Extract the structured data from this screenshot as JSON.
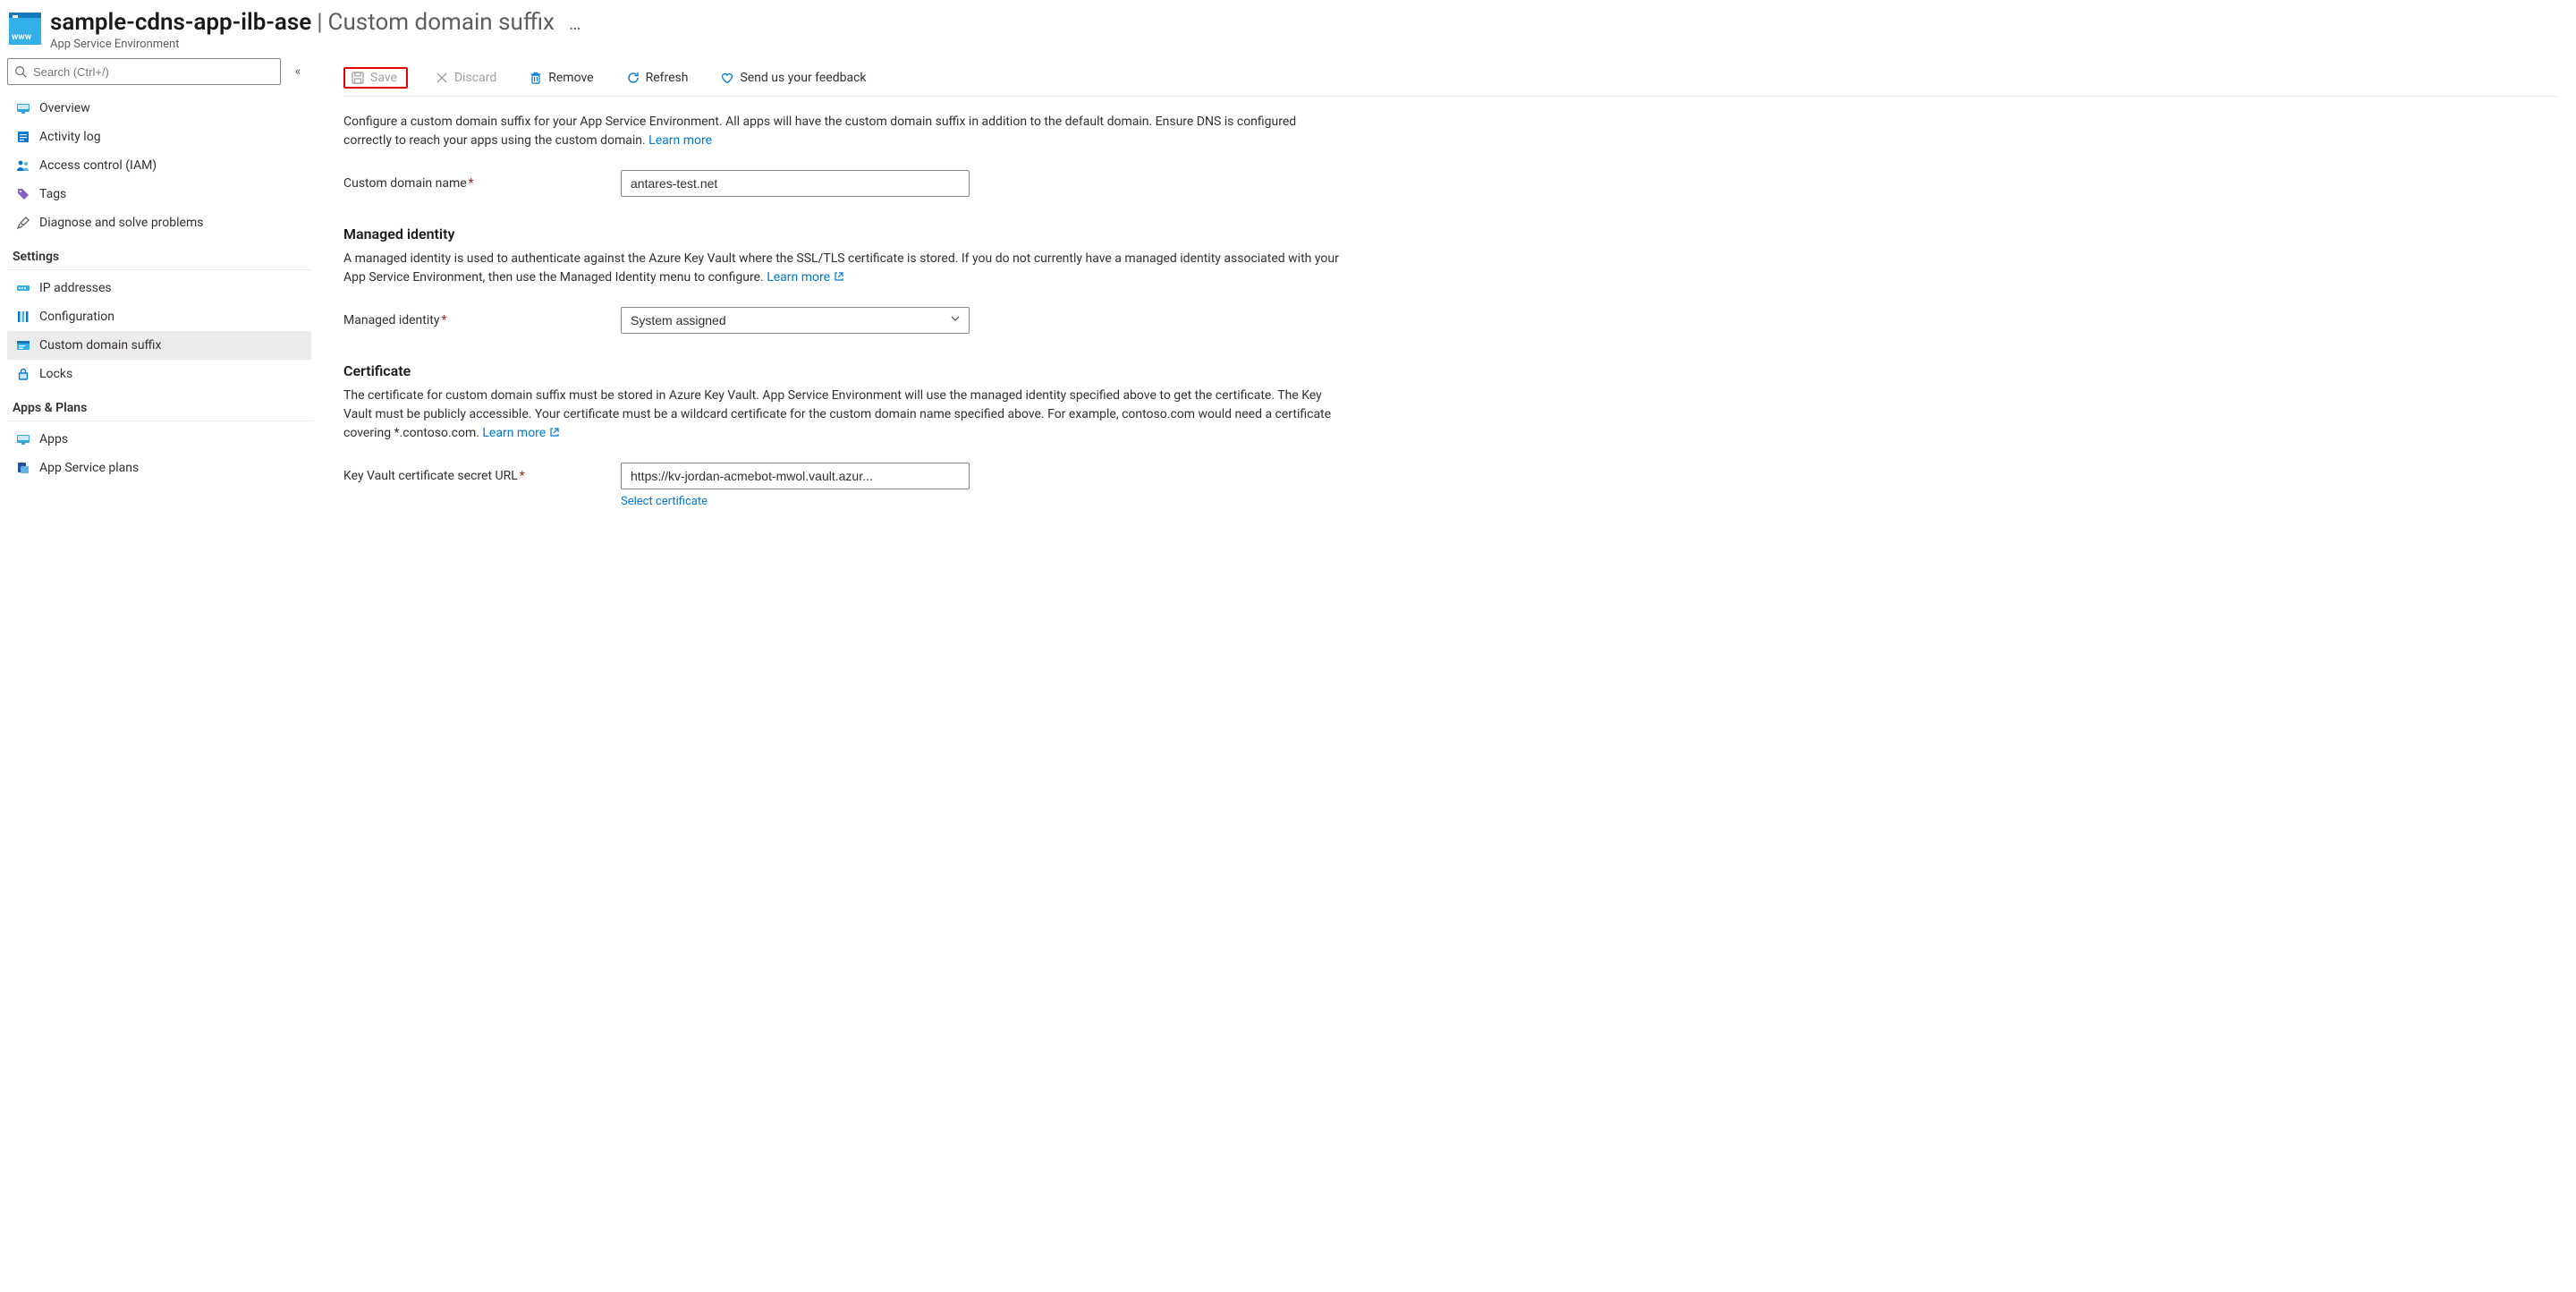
{
  "header": {
    "resource_name": "sample-cdns-app-ilb-ase",
    "separator": "|",
    "blade_name": "Custom domain suffix",
    "resource_type": "App Service Environment",
    "more": "…"
  },
  "search": {
    "placeholder": "Search (Ctrl+/)"
  },
  "sidebar": {
    "items": [
      {
        "label": "Overview"
      },
      {
        "label": "Activity log"
      },
      {
        "label": "Access control (IAM)"
      },
      {
        "label": "Tags"
      },
      {
        "label": "Diagnose and solve problems"
      }
    ],
    "settings_label": "Settings",
    "settings": [
      {
        "label": "IP addresses"
      },
      {
        "label": "Configuration"
      },
      {
        "label": "Custom domain suffix"
      },
      {
        "label": "Locks"
      }
    ],
    "apps_label": "Apps & Plans",
    "apps": [
      {
        "label": "Apps"
      },
      {
        "label": "App Service plans"
      }
    ]
  },
  "toolbar": {
    "save": "Save",
    "discard": "Discard",
    "remove": "Remove",
    "refresh": "Refresh",
    "feedback": "Send us your feedback"
  },
  "content": {
    "intro_text": "Configure a custom domain suffix for your App Service Environment. All apps will have the custom domain suffix in addition to the default domain. Ensure DNS is configured correctly to reach your apps using the custom domain. ",
    "learn_more": "Learn more",
    "custom_domain_label": "Custom domain name",
    "custom_domain_value": "antares-test.net",
    "managed_identity_heading": "Managed identity",
    "managed_identity_desc": "A managed identity is used to authenticate against the Azure Key Vault where the SSL/TLS certificate is stored. If you do not currently have a managed identity associated with your App Service Environment, then use the Managed Identity menu to configure. ",
    "managed_identity_label": "Managed identity",
    "managed_identity_value": "System assigned",
    "certificate_heading": "Certificate",
    "certificate_desc": "The certificate for custom domain suffix must be stored in Azure Key Vault. App Service Environment will use the managed identity specified above to get the certificate. The Key Vault must be publicly accessible. Your certificate must be a wildcard certificate for the custom domain name specified above. For example, contoso.com would need a certificate covering *.contoso.com. ",
    "kv_url_label": "Key Vault certificate secret URL",
    "kv_url_value": "https://kv-jordan-acmebot-mwol.vault.azur...",
    "select_certificate": "Select certificate"
  }
}
